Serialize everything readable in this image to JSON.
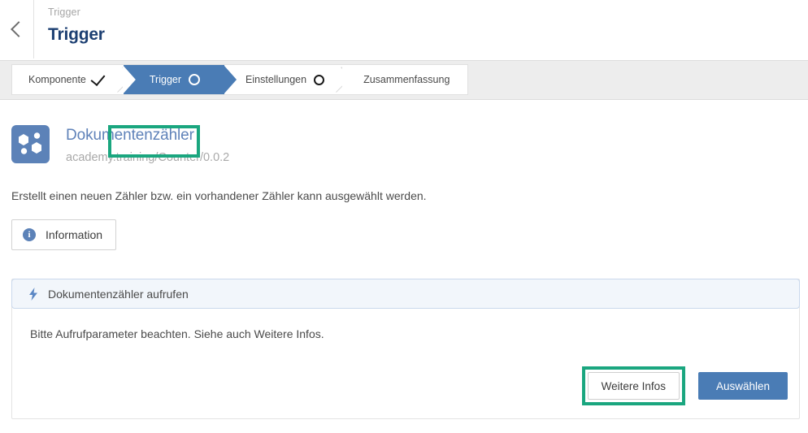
{
  "header": {
    "back_icon": "chevron-left-icon",
    "breadcrumb": "Trigger",
    "title": "Trigger"
  },
  "stepper": {
    "steps": [
      {
        "label": "Komponente",
        "state": "completed",
        "icon": "check-icon"
      },
      {
        "label": "Trigger",
        "state": "active",
        "icon": "circle-icon"
      },
      {
        "label": "Einstellungen",
        "state": "upcoming",
        "icon": "circle-icon"
      },
      {
        "label": "Zusammenfassung",
        "state": "upcoming",
        "icon": ""
      }
    ],
    "highlight_color": "#1aa67f",
    "active_color": "#4a7cb5"
  },
  "app": {
    "icon": "hexagons-icon",
    "icon_color": "#5c82b8",
    "name": "Dokumentenzähler",
    "identifier": "academy.training/Counter/0.0.2"
  },
  "content": {
    "description": "Erstellt einen neuen Zähler bzw. ein vorhandener Zähler kann ausgewählt werden.",
    "info_button": {
      "label": "Information",
      "icon": "info-icon"
    }
  },
  "card": {
    "header": {
      "icon": "lightning-bolt-icon",
      "title": "Dokumentenzähler aufrufen",
      "background": "#f2f6fb",
      "border": "#c9d8ec"
    },
    "body_text": "Bitte Aufrufparameter beachten. Siehe auch Weitere Infos.",
    "actions": {
      "secondary_label": "Weitere Infos",
      "secondary_highlighted": true,
      "primary_label": "Auswählen",
      "primary_color": "#4a7cb5"
    }
  }
}
